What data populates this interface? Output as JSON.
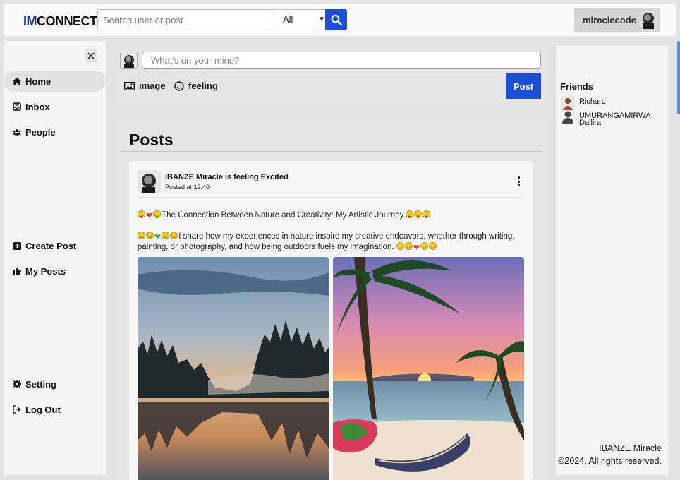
{
  "brand": {
    "im": "IM",
    "connect": "CONNECT"
  },
  "search": {
    "placeholder": "Search user or post",
    "filter_value": "All"
  },
  "user": {
    "username": "miraclecode"
  },
  "sidebar": {
    "items": [
      {
        "label": "Home",
        "icon": "home-icon",
        "active": true
      },
      {
        "label": "Inbox",
        "icon": "inbox-icon"
      },
      {
        "label": "People",
        "icon": "people-icon"
      },
      {
        "label": "Create Post",
        "icon": "plus-square-icon"
      },
      {
        "label": "My Posts",
        "icon": "thumbs-up-icon"
      },
      {
        "label": "Setting",
        "icon": "gear-icon"
      },
      {
        "label": "Log Out",
        "icon": "logout-icon"
      }
    ]
  },
  "composer": {
    "placeholder": "What's on your mind?",
    "image_label": "image",
    "feeling_label": "feeling",
    "post_label": "Post"
  },
  "feed": {
    "title": "Posts"
  },
  "post": {
    "author_line": "IBANZE Miracle is feeling Excited",
    "time": "Posted at 19:40",
    "line1": "The Connection Between Nature and Creativity: My Artistic Journey.",
    "line2": "I share how my experiences in nature inspire my creative endeavors, whether through writing, painting, or photography, and how being outdoors fuels my imagination."
  },
  "friends": {
    "title": "Friends",
    "list": [
      {
        "name": "Richard"
      },
      {
        "name_line1": "UMURANGAMIRWA",
        "name_line2": "Dallira"
      }
    ]
  },
  "footer": {
    "name": "IBANZE Miracle",
    "copy": "©2024, All rights reserved."
  },
  "colors": {
    "accent": "#1d4ed8",
    "brand_im": "#1d2a8c"
  }
}
